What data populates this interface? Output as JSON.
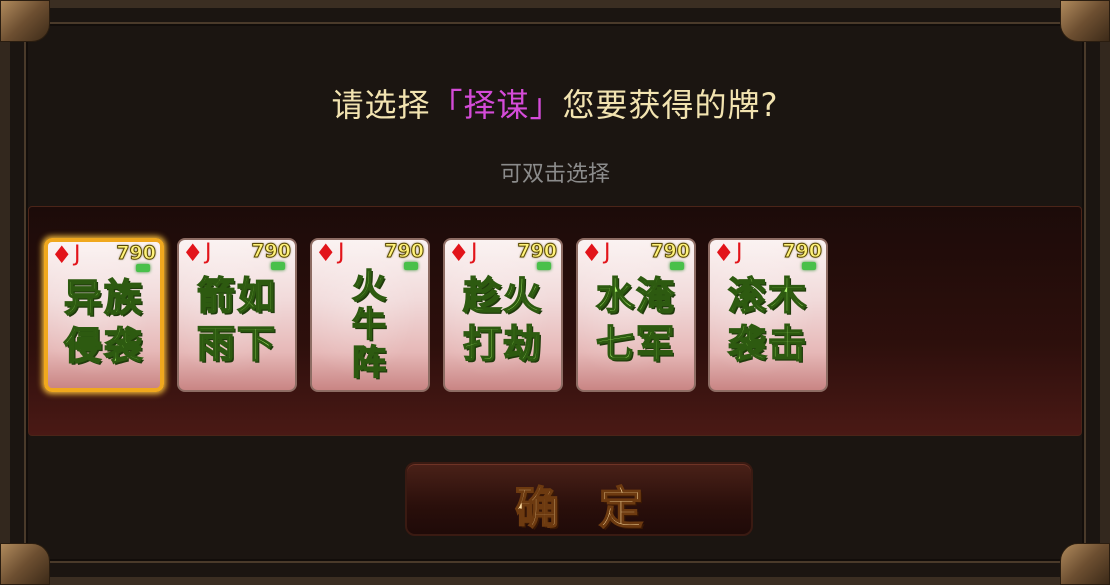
{
  "prompt": {
    "prefix": "请选择",
    "skill": "「择谋」",
    "suffix": "您要获得的牌?"
  },
  "hint": "可双击选择",
  "cards": [
    {
      "suit": "♦",
      "rank": "J",
      "cost": "790",
      "name": "异族侵袭",
      "lines": [
        "异族",
        "侵袭"
      ],
      "selected": true
    },
    {
      "suit": "♦",
      "rank": "J",
      "cost": "790",
      "name": "箭如雨下",
      "lines": [
        "箭如",
        "雨下"
      ],
      "selected": false
    },
    {
      "suit": "♦",
      "rank": "J",
      "cost": "790",
      "name": "火牛阵",
      "lines": [
        "火",
        "牛",
        "阵"
      ],
      "selected": false
    },
    {
      "suit": "♦",
      "rank": "J",
      "cost": "790",
      "name": "趁火打劫",
      "lines": [
        "趁火",
        "打劫"
      ],
      "selected": false
    },
    {
      "suit": "♦",
      "rank": "J",
      "cost": "790",
      "name": "水淹七军",
      "lines": [
        "水淹",
        "七军"
      ],
      "selected": false
    },
    {
      "suit": "♦",
      "rank": "J",
      "cost": "790",
      "name": "滚木袭击",
      "lines": [
        "滚木",
        "袭击"
      ],
      "selected": false
    }
  ],
  "confirm_label": "确定",
  "colors": {
    "title": "#f2e3b0",
    "skill": "#d44bd8",
    "hint": "#8b8b8b",
    "card_name": "#a9f06a",
    "selected_border": "#f0a81e",
    "suit_red": "#e2141a"
  }
}
